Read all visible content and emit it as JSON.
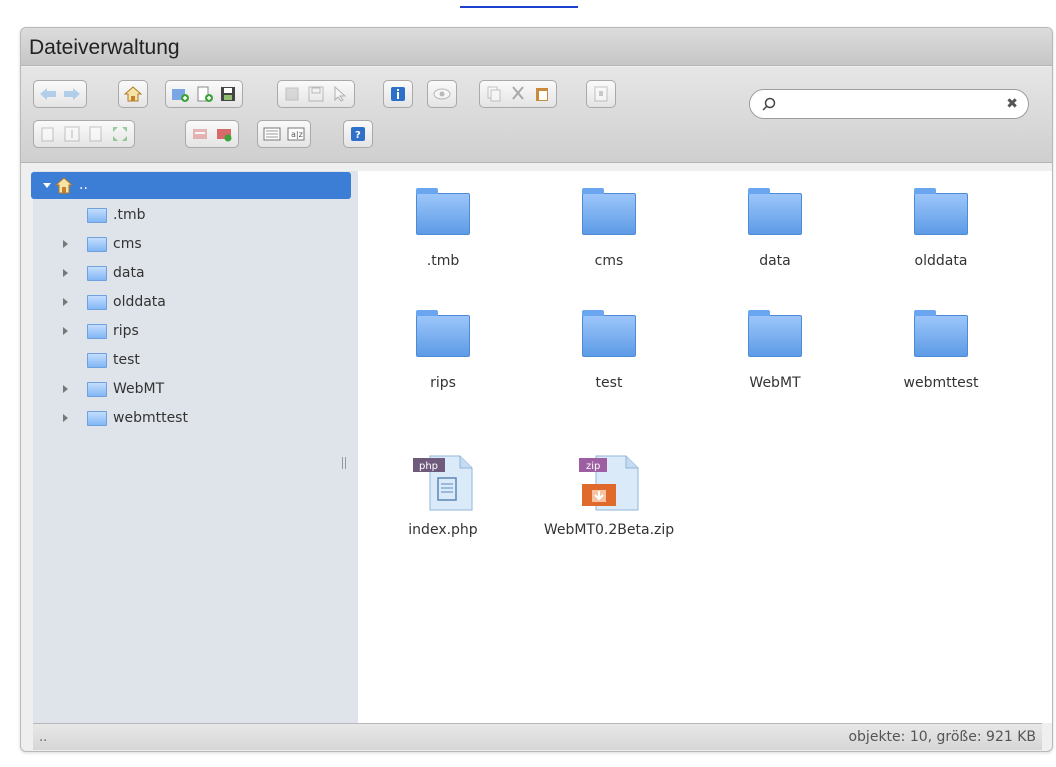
{
  "window": {
    "title": "Dateiverwaltung"
  },
  "search": {
    "placeholder": "",
    "value": ""
  },
  "tree": {
    "root_label": "..",
    "items": [
      {
        "label": ".tmb",
        "expandable": false
      },
      {
        "label": "cms",
        "expandable": true
      },
      {
        "label": "data",
        "expandable": true
      },
      {
        "label": "olddata",
        "expandable": true
      },
      {
        "label": "rips",
        "expandable": true
      },
      {
        "label": "test",
        "expandable": false
      },
      {
        "label": "WebMT",
        "expandable": true
      },
      {
        "label": "webmttest",
        "expandable": true
      }
    ]
  },
  "files": [
    {
      "name": ".tmb",
      "kind": "folder"
    },
    {
      "name": "cms",
      "kind": "folder"
    },
    {
      "name": "data",
      "kind": "folder"
    },
    {
      "name": "olddata",
      "kind": "folder"
    },
    {
      "name": "rips",
      "kind": "folder"
    },
    {
      "name": "test",
      "kind": "folder"
    },
    {
      "name": "WebMT",
      "kind": "folder"
    },
    {
      "name": "webmttest",
      "kind": "folder"
    },
    {
      "name": "index.php",
      "kind": "php",
      "badge": "php"
    },
    {
      "name": "WebMT0.2Beta.zip",
      "kind": "zip",
      "badge": "zip"
    }
  ],
  "status": {
    "path": "..",
    "summary": "objekte: 10, größe: 921 KB"
  },
  "colors": {
    "selection": "#3c7dd6",
    "folder": "#7fb3f2",
    "php_badge": "#6f5a7c",
    "zip_badge": "#9d5fa1",
    "zip_box": "#e06a2c"
  }
}
